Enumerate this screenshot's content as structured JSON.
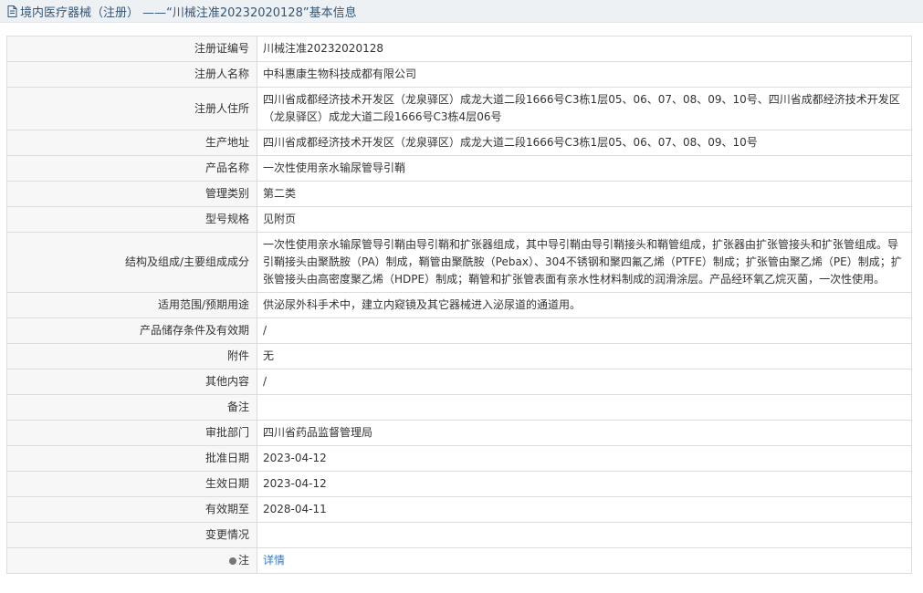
{
  "header": {
    "title": "境内医疗器械（注册） ——“川械注准20232020128”基本信息"
  },
  "rows": [
    {
      "label": "注册证编号",
      "value": "川械注准20232020128"
    },
    {
      "label": "注册人名称",
      "value": "中科惠康生物科技成都有限公司"
    },
    {
      "label": "注册人住所",
      "value": "四川省成都经济技术开发区（龙泉驿区）成龙大道二段1666号C3栋1层05、06、07、08、09、10号、四川省成都经济技术开发区（龙泉驿区）成龙大道二段1666号C3栋4层06号"
    },
    {
      "label": "生产地址",
      "value": "四川省成都经济技术开发区（龙泉驿区）成龙大道二段1666号C3栋1层05、06、07、08、09、10号"
    },
    {
      "label": "产品名称",
      "value": "一次性使用亲水输尿管导引鞘"
    },
    {
      "label": "管理类别",
      "value": "第二类"
    },
    {
      "label": "型号规格",
      "value": "见附页"
    },
    {
      "label": "结构及组成/主要组成成分",
      "value": "一次性使用亲水输尿管导引鞘由导引鞘和扩张器组成，其中导引鞘由导引鞘接头和鞘管组成，扩张器由扩张管接头和扩张管组成。导引鞘接头由聚酰胺（PA）制成，鞘管由聚酰胺（Pebax）、304不锈钢和聚四氟乙烯（PTFE）制成；扩张管由聚乙烯（PE）制成；扩张管接头由高密度聚乙烯（HDPE）制成；鞘管和扩张管表面有亲水性材料制成的润滑涂层。产品经环氧乙烷灭菌，一次性使用。"
    },
    {
      "label": "适用范围/预期用途",
      "value": "供泌尿外科手术中，建立内窥镜及其它器械进入泌尿道的通道用。"
    },
    {
      "label": "产品储存条件及有效期",
      "value": "/"
    },
    {
      "label": "附件",
      "value": "无"
    },
    {
      "label": "其他内容",
      "value": "/"
    },
    {
      "label": "备注",
      "value": ""
    },
    {
      "label": "审批部门",
      "value": "四川省药品监督管理局"
    },
    {
      "label": "批准日期",
      "value": "2023-04-12"
    },
    {
      "label": "生效日期",
      "value": "2023-04-12"
    },
    {
      "label": "有效期至",
      "value": "2028-04-11"
    },
    {
      "label": "变更情况",
      "value": ""
    }
  ],
  "note": {
    "label": "注",
    "icon": "lightbulb-icon",
    "link_text": "详情"
  }
}
